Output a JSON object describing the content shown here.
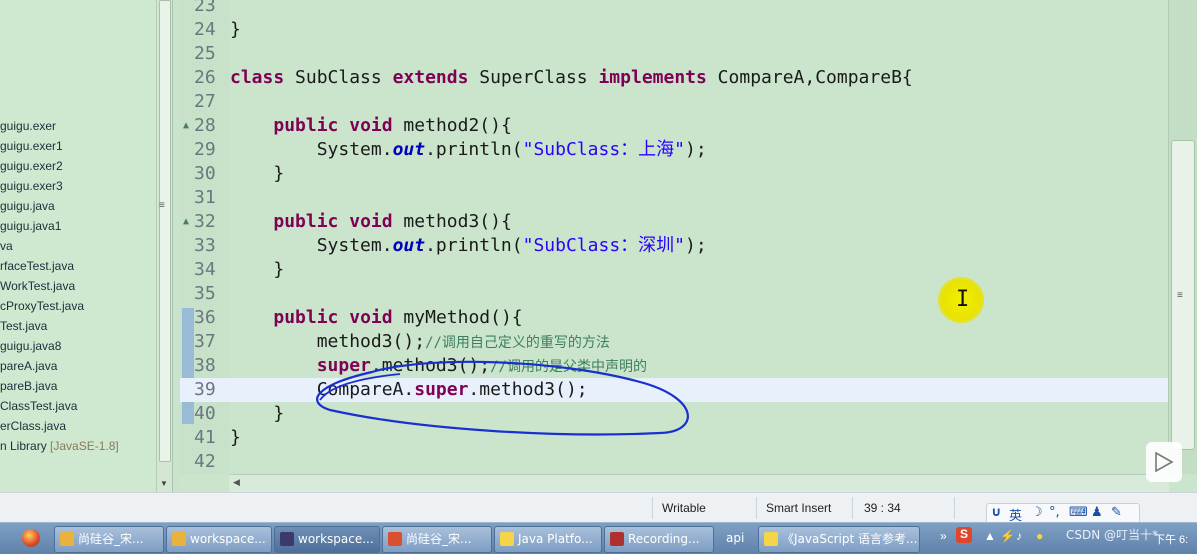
{
  "explorer": {
    "items": [
      {
        "text": "guigu.exer"
      },
      {
        "text": "guigu.exer1"
      },
      {
        "text": "guigu.exer2"
      },
      {
        "text": "guigu.exer3"
      },
      {
        "text": "guigu.java"
      },
      {
        "text": "guigu.java1"
      },
      {
        "text": "va"
      },
      {
        "text": "rfaceTest.java"
      },
      {
        "text": "WorkTest.java"
      },
      {
        "text": "cProxyTest.java"
      },
      {
        "text": "Test.java"
      },
      {
        "text": "guigu.java8"
      },
      {
        "text": "pareA.java"
      },
      {
        "text": "pareB.java"
      },
      {
        "text": "ClassTest.java"
      },
      {
        "text": "erClass.java"
      },
      {
        "text": "n Library",
        "suffix": "[JavaSE-1.8]"
      }
    ]
  },
  "editor": {
    "lines": [
      {
        "num": "23",
        "fold": "",
        "parts": []
      },
      {
        "num": "24",
        "fold": "",
        "parts": [
          {
            "t": "}",
            "c": "plain"
          }
        ]
      },
      {
        "num": "25",
        "fold": "",
        "parts": []
      },
      {
        "num": "26",
        "fold": "",
        "parts": [
          {
            "t": "class",
            "c": "kw"
          },
          {
            "t": " SubClass ",
            "c": "plain"
          },
          {
            "t": "extends",
            "c": "kw"
          },
          {
            "t": " SuperClass ",
            "c": "plain"
          },
          {
            "t": "implements",
            "c": "kw"
          },
          {
            "t": " CompareA,CompareB{",
            "c": "plain"
          }
        ]
      },
      {
        "num": "27",
        "fold": "",
        "parts": []
      },
      {
        "num": "28",
        "fold": "▲",
        "parts": [
          {
            "t": "    ",
            "c": "plain"
          },
          {
            "t": "public",
            "c": "kw"
          },
          {
            "t": " ",
            "c": "plain"
          },
          {
            "t": "void",
            "c": "kw"
          },
          {
            "t": " method2(){",
            "c": "plain"
          }
        ]
      },
      {
        "num": "29",
        "fold": "",
        "parts": [
          {
            "t": "        System.",
            "c": "plain"
          },
          {
            "t": "out",
            "c": "field"
          },
          {
            "t": ".println(",
            "c": "plain"
          },
          {
            "t": "\"SubClass：上海\"",
            "c": "str"
          },
          {
            "t": ");",
            "c": "plain"
          }
        ]
      },
      {
        "num": "30",
        "fold": "",
        "parts": [
          {
            "t": "    }",
            "c": "plain"
          }
        ]
      },
      {
        "num": "31",
        "fold": "",
        "parts": []
      },
      {
        "num": "32",
        "fold": "▲",
        "parts": [
          {
            "t": "    ",
            "c": "plain"
          },
          {
            "t": "public",
            "c": "kw"
          },
          {
            "t": " ",
            "c": "plain"
          },
          {
            "t": "void",
            "c": "kw"
          },
          {
            "t": " method3(){",
            "c": "plain"
          }
        ]
      },
      {
        "num": "33",
        "fold": "",
        "parts": [
          {
            "t": "        System.",
            "c": "plain"
          },
          {
            "t": "out",
            "c": "field"
          },
          {
            "t": ".println(",
            "c": "plain"
          },
          {
            "t": "\"SubClass：深圳\"",
            "c": "str"
          },
          {
            "t": ");",
            "c": "plain"
          }
        ]
      },
      {
        "num": "34",
        "fold": "",
        "parts": [
          {
            "t": "    }",
            "c": "plain"
          }
        ]
      },
      {
        "num": "35",
        "fold": "",
        "parts": []
      },
      {
        "num": "36",
        "fold": "",
        "parts": [
          {
            "t": "    ",
            "c": "plain"
          },
          {
            "t": "public",
            "c": "kw"
          },
          {
            "t": " ",
            "c": "plain"
          },
          {
            "t": "void",
            "c": "kw"
          },
          {
            "t": " myMethod(){",
            "c": "plain"
          }
        ]
      },
      {
        "num": "37",
        "fold": "",
        "parts": [
          {
            "t": "        method3();",
            "c": "plain"
          },
          {
            "t": "//调用自己定义的重写的方法",
            "c": "cmt"
          }
        ]
      },
      {
        "num": "38",
        "fold": "",
        "parts": [
          {
            "t": "        ",
            "c": "plain"
          },
          {
            "t": "super",
            "c": "kw"
          },
          {
            "t": ".method3();",
            "c": "plain"
          },
          {
            "t": "//调用的是父类中声明的",
            "c": "cmt"
          }
        ]
      },
      {
        "num": "39",
        "fold": "",
        "current": true,
        "parts": [
          {
            "t": "        CompareA.",
            "c": "plain"
          },
          {
            "t": "super",
            "c": "kw"
          },
          {
            "t": ".method3();",
            "c": "plain"
          }
        ]
      },
      {
        "num": "40",
        "fold": "",
        "parts": [
          {
            "t": "    }",
            "c": "plain"
          }
        ]
      },
      {
        "num": "41",
        "fold": "",
        "parts": [
          {
            "t": "}",
            "c": "plain"
          }
        ]
      },
      {
        "num": "42",
        "fold": "",
        "parts": []
      }
    ]
  },
  "statusbar": {
    "writable": "Writable",
    "insert_mode": "Smart Insert",
    "position": "39 : 34"
  },
  "ime": {
    "lang": "英"
  },
  "taskbar": {
    "items": [
      {
        "label": "尚硅谷_宋...",
        "icon_color": "#e8b23c",
        "active": false
      },
      {
        "label": "workspace...",
        "icon_color": "#e8b23c",
        "active": false
      },
      {
        "label": "workspace...",
        "icon_color": "#3b3b6a",
        "active": true
      },
      {
        "label": "尚硅谷_宋...",
        "icon_color": "#d9502e",
        "active": false
      },
      {
        "label": "Java Platfo...",
        "icon_color": "#f3d54a",
        "active": false
      },
      {
        "label": "Recording...",
        "icon_color": "#b03030",
        "active": false
      },
      {
        "label": "api",
        "icon_color": "",
        "active": false
      },
      {
        "label": "《JavaScript 语言参考...",
        "icon_color": "#f3d54a",
        "active": false
      }
    ],
    "more": "»",
    "clock": "下午 6:"
  },
  "watermark": "CSDN @叮当十*"
}
